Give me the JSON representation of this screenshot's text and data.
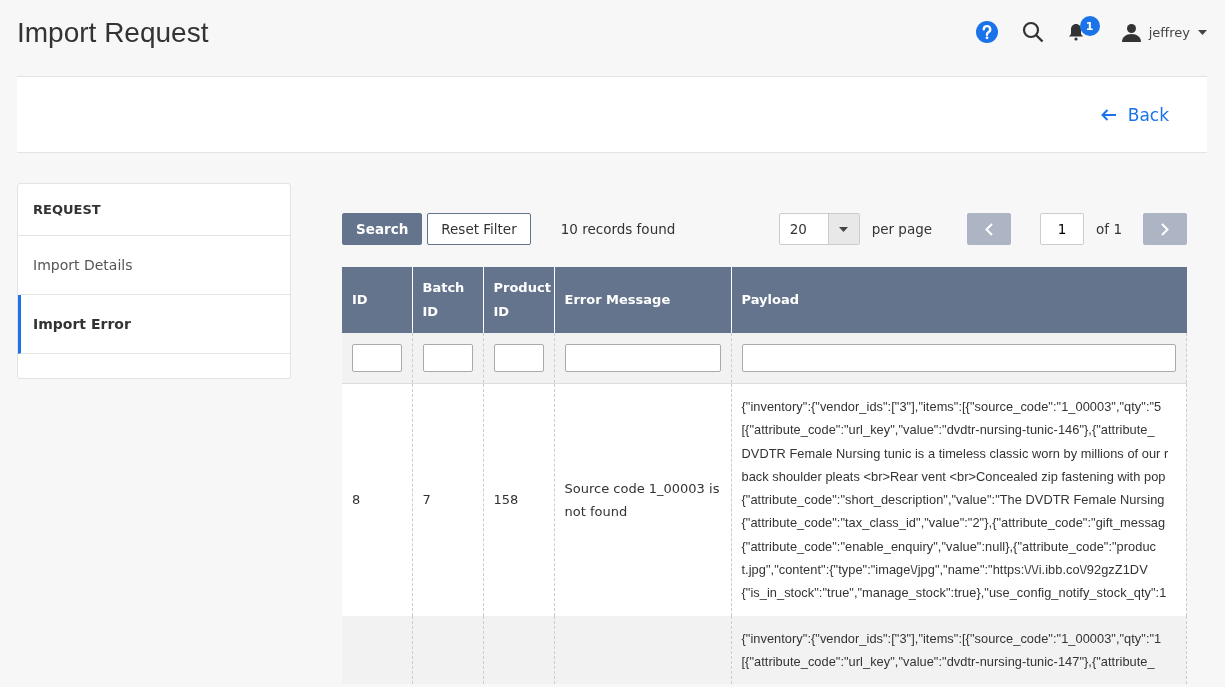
{
  "page_title": "Import Request",
  "top_bar": {
    "notifications": "1",
    "user": "jeffrey"
  },
  "action_bar": {
    "back": "Back"
  },
  "sidebar": {
    "heading": "REQUEST",
    "items": [
      {
        "label": "Import Details",
        "selected": false
      },
      {
        "label": "Import Error",
        "selected": true
      }
    ]
  },
  "toolbar": {
    "search": "Search",
    "reset": "Reset Filter",
    "records": "10 records found",
    "page_size": "20",
    "per_page": "per page",
    "page": "1",
    "of": "of 1"
  },
  "table": {
    "columns": [
      {
        "label": "ID"
      },
      {
        "label": "Batch ID"
      },
      {
        "label": "Product ID"
      },
      {
        "label": "Error Message"
      },
      {
        "label": "Payload"
      }
    ],
    "rows": [
      {
        "id": "8",
        "batch_id": "7",
        "product_id": "158",
        "error_message": "Source code 1_00003 is not found",
        "payload": [
          "{\"inventory\":{\"vendor_ids\":[\"3\"],\"items\":[{\"source_code\":\"1_00003\",\"qty\":\"5",
          "[{\"attribute_code\":\"url_key\",\"value\":\"dvdtr-nursing-tunic-146\"},{\"attribute_",
          "DVDTR Female Nursing tunic is a timeless classic worn by millions of our r",
          "back shoulder pleats <br>Rear vent <br>Concealed zip fastening with pop",
          "{\"attribute_code\":\"short_description\",\"value\":\"The DVDTR Female Nursing",
          "{\"attribute_code\":\"tax_class_id\",\"value\":\"2\"},{\"attribute_code\":\"gift_messag",
          "{\"attribute_code\":\"enable_enquiry\",\"value\":null},{\"attribute_code\":\"produc",
          "t.jpg\",\"content\":{\"type\":\"image\\/jpg\",\"name\":\"https:\\/\\/i.ibb.co\\/92gzZ1DV",
          "{\"is_in_stock\":\"true\",\"manage_stock\":true},\"use_config_notify_stock_qty\":1"
        ]
      },
      {
        "payload": [
          "{\"inventory\":{\"vendor_ids\":[\"3\"],\"items\":[{\"source_code\":\"1_00003\",\"qty\":\"1",
          "[{\"attribute_code\":\"url_key\",\"value\":\"dvdtr-nursing-tunic-147\"},{\"attribute_"
        ]
      }
    ]
  }
}
